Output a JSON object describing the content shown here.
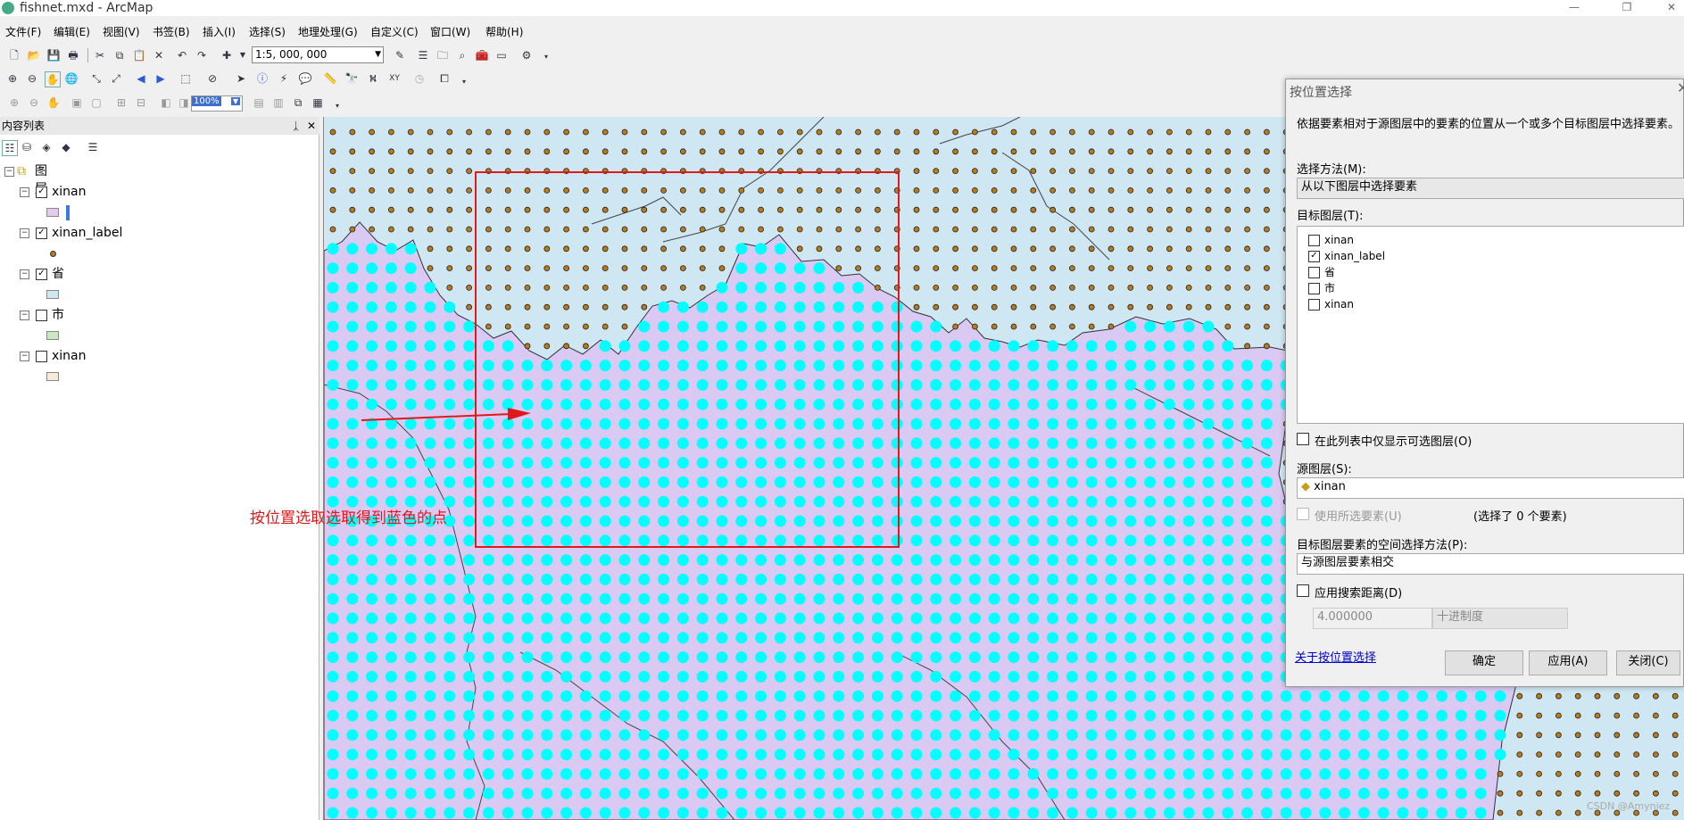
{
  "window": {
    "title": "fishnet.mxd - ArcMap",
    "min": "—",
    "max": "❐",
    "close": "✕"
  },
  "menu": [
    "文件(F)",
    "编辑(E)",
    "视图(V)",
    "书签(B)",
    "插入(I)",
    "选择(S)",
    "地理处理(G)",
    "自定义(C)",
    "窗口(W)",
    "帮助(H)"
  ],
  "toolbar": {
    "scale": "1:5, 000, 000",
    "zoom": "100%"
  },
  "toc": {
    "title": "内容列表",
    "pin": "ᛣ",
    "close": "✕",
    "root": "图层",
    "layers": [
      {
        "name": "xinan",
        "checked": true,
        "swatch": "#e6c9f0"
      },
      {
        "name": "xinan_label",
        "checked": true,
        "swatch": "point"
      },
      {
        "name": "省",
        "checked": true,
        "swatch": "#cfe7f3"
      },
      {
        "name": "市",
        "checked": false,
        "swatch": "#cbe8c4"
      },
      {
        "name": "xinan",
        "checked": false,
        "swatch": "#f6ead8"
      }
    ]
  },
  "map": {
    "annotation": "按位置选取选取得到蓝色的点",
    "watermark": "CSDN @Amyniez",
    "colors": {
      "ocean": "#cfe7f3",
      "region": "#d9c9f3",
      "selected": "#00ffff",
      "point": "#b87a1a",
      "frame": "#e0191b"
    }
  },
  "dialog": {
    "title": "按位置选择",
    "description": "依据要素相对于源图层中的要素的位置从一个或多个目标图层中选择要素。",
    "method_label": "选择方法(M):",
    "method_value": "从以下图层中选择要素",
    "target_label": "目标图层(T):",
    "targets": [
      {
        "name": "xinan",
        "checked": false
      },
      {
        "name": "xinan_label",
        "checked": true
      },
      {
        "name": "省",
        "checked": false
      },
      {
        "name": "市",
        "checked": false
      },
      {
        "name": "xinan",
        "checked": false
      }
    ],
    "only_selectable": "在此列表中仅显示可选图层(O)",
    "source_label": "源图层(S):",
    "source_value": "xinan",
    "use_selected": "使用所选要素(U)",
    "selected_count": "(选择了 0 个要素)",
    "spatial_label": "目标图层要素的空间选择方法(P):",
    "spatial_value": "与源图层要素相交",
    "search_distance": "应用搜索距离(D)",
    "distance_value": "4.000000",
    "unit_value": "十进制度",
    "help_link": "关于按位置选择",
    "ok": "确定",
    "apply": "应用(A)",
    "close": "关闭(C)"
  }
}
